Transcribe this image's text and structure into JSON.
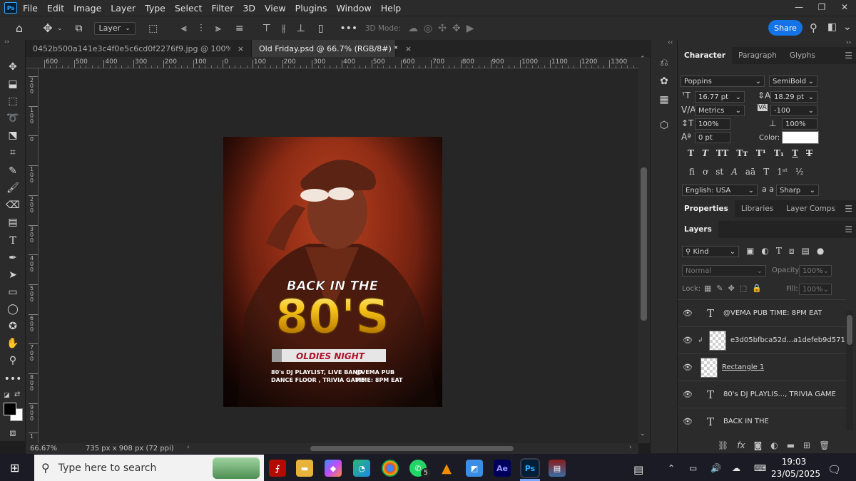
{
  "app": {
    "logo": "Ps"
  },
  "menubar": {
    "items": [
      "File",
      "Edit",
      "Image",
      "Layer",
      "Type",
      "Select",
      "Filter",
      "3D",
      "View",
      "Plugins",
      "Window",
      "Help"
    ]
  },
  "optionsbar": {
    "layer_select": "Layer",
    "mode_3d_label": "3D Mode:",
    "share_label": "Share"
  },
  "tabs": [
    {
      "label": "0452b500a141e3c4f0e5c6cd0f2276f9.jpg @ 100% (RGB/8)",
      "close": "×"
    },
    {
      "label": "Old Friday.psd @ 66.7% (RGB/8#) *",
      "close": "×"
    }
  ],
  "ruler": {
    "h_labels": [
      "600",
      "500",
      "400",
      "300",
      "200",
      "100",
      "0",
      "100",
      "200",
      "300",
      "400",
      "500",
      "600",
      "700",
      "800",
      "900",
      "1000",
      "1100",
      "1200",
      "1300"
    ],
    "v_labels": [
      "200",
      "100",
      "0",
      "100",
      "200",
      "300",
      "400",
      "500",
      "600",
      "700",
      "800",
      "900",
      "1"
    ]
  },
  "poster": {
    "line1": "BACK IN THE",
    "big": "80'S",
    "band": "OLDIES NIGHT",
    "left_text_1": "80's DJ PLAYLIST, LIVE BAND",
    "left_text_2": "DANCE FLOOR , TRIVIA GAME",
    "right_text_1": "@VEMA PUB",
    "right_text_2": "TIME: 8PM EAT"
  },
  "status": {
    "zoom": "66.67%",
    "doc_size": "735 px x 908 px (72 ppi)"
  },
  "character": {
    "tabs": [
      "Character",
      "Paragraph",
      "Glyphs"
    ],
    "font_family": "Poppins",
    "font_style": "SemiBold",
    "font_size": "16.77 pt",
    "leading": "18.29 pt",
    "kerning": "Metrics",
    "tracking": "-100",
    "vscale": "100%",
    "hscale": "100%",
    "baseline": "0 pt",
    "color_label": "Color:",
    "language": "English: USA",
    "aa_label": "a a",
    "antialias": "Sharp"
  },
  "properties": {
    "tabs": [
      "Properties",
      "Libraries",
      "Layer Comps"
    ]
  },
  "layers_panel": {
    "title": "Layers",
    "filter_kind": "Kind",
    "blend_mode": "Normal",
    "opacity_label": "Opacity:",
    "opacity": "100%",
    "lock_label": "Lock:",
    "fill_label": "Fill:",
    "fill": "100%",
    "layers": [
      {
        "type": "T",
        "name": "@VEMA  PUB TIME: 8PM EAT"
      },
      {
        "type": "img",
        "name": "e3d05bfbca52d...a1defeb9d571"
      },
      {
        "type": "img",
        "name": "Rectangle 1"
      },
      {
        "type": "T",
        "name": "80's DJ PLAYLIS...,  TRIVIA GAME"
      },
      {
        "type": "T",
        "name": "BACK IN THE"
      }
    ]
  },
  "taskbar": {
    "search_placeholder": "Type here to search",
    "apps": [
      "Ae",
      "Ps"
    ],
    "whatsapp_badge": "5",
    "time": "19:03",
    "date": "23/05/2025"
  },
  "colors": {
    "accent": "#1473e6",
    "poster_red": "#b8401f",
    "gold": "#f2b90c"
  }
}
